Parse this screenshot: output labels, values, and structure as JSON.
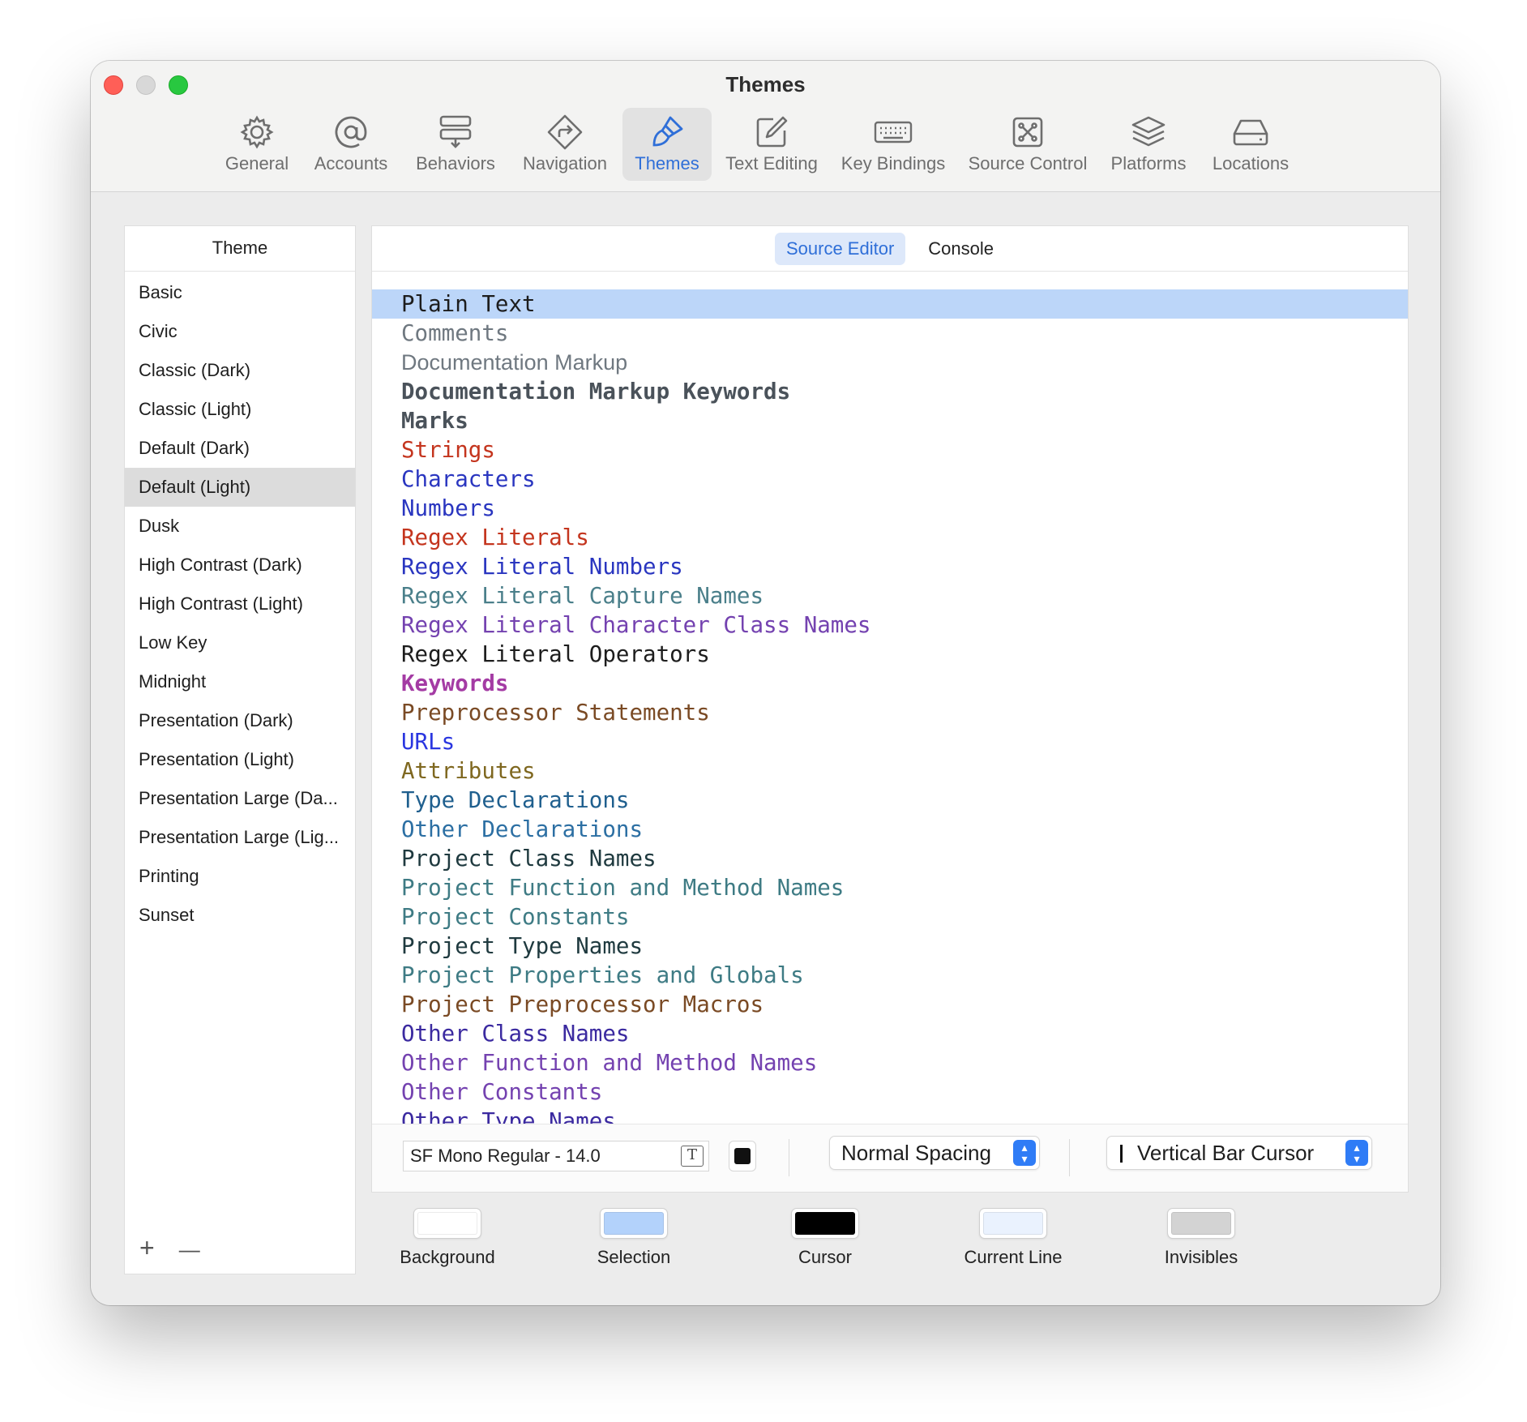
{
  "window": {
    "title": "Themes"
  },
  "toolbar": {
    "items": [
      {
        "label": "General",
        "icon": "gear-icon"
      },
      {
        "label": "Accounts",
        "icon": "at-icon"
      },
      {
        "label": "Behaviors",
        "icon": "behaviors-icon"
      },
      {
        "label": "Navigation",
        "icon": "navigation-icon"
      },
      {
        "label": "Themes",
        "icon": "paintbrush-icon"
      },
      {
        "label": "Text Editing",
        "icon": "pencil-square-icon"
      },
      {
        "label": "Key Bindings",
        "icon": "keyboard-icon"
      },
      {
        "label": "Source Control",
        "icon": "source-control-icon"
      },
      {
        "label": "Platforms",
        "icon": "layers-icon"
      },
      {
        "label": "Locations",
        "icon": "drive-icon"
      }
    ],
    "active": "Themes"
  },
  "themes": {
    "header": "Theme",
    "items": [
      "Basic",
      "Civic",
      "Classic (Dark)",
      "Classic (Light)",
      "Default (Dark)",
      "Default (Light)",
      "Dusk",
      "High Contrast (Dark)",
      "High Contrast (Light)",
      "Low Key",
      "Midnight",
      "Presentation (Dark)",
      "Presentation (Light)",
      "Presentation Large (Da...",
      "Presentation Large (Lig...",
      "Printing",
      "Sunset"
    ],
    "selected": "Default (Light)",
    "add_label": "+",
    "remove_label": "—"
  },
  "editor": {
    "tabs": [
      "Source Editor",
      "Console"
    ],
    "active_tab": "Source Editor",
    "tokens": [
      {
        "label": "Plain Text",
        "color": "#1d1d1d",
        "bold": false,
        "selected": true
      },
      {
        "label": "Comments",
        "color": "#6f7880",
        "bold": false
      },
      {
        "label": "Documentation Markup",
        "color": "#6f7880",
        "bold": false,
        "proportional": true
      },
      {
        "label": "Documentation Markup Keywords",
        "color": "#4a525a",
        "bold": true
      },
      {
        "label": "Marks",
        "color": "#4a525a",
        "bold": true
      },
      {
        "label": "Strings",
        "color": "#c4351e",
        "bold": false
      },
      {
        "label": "Characters",
        "color": "#2a36c0",
        "bold": false
      },
      {
        "label": "Numbers",
        "color": "#2a36c0",
        "bold": false
      },
      {
        "label": "Regex Literals",
        "color": "#c4351e",
        "bold": false
      },
      {
        "label": "Regex Literal Numbers",
        "color": "#2a36c0",
        "bold": false
      },
      {
        "label": "Regex Literal Capture Names",
        "color": "#4a7f8a",
        "bold": false
      },
      {
        "label": "Regex Literal Character Class Names",
        "color": "#7442b0",
        "bold": false
      },
      {
        "label": "Regex Literal Operators",
        "color": "#1d1d1d",
        "bold": false
      },
      {
        "label": "Keywords",
        "color": "#a43ba4",
        "bold": true
      },
      {
        "label": "Preprocessor Statements",
        "color": "#7a4a24",
        "bold": false
      },
      {
        "label": "URLs",
        "color": "#2a36e0",
        "bold": false
      },
      {
        "label": "Attributes",
        "color": "#7f6820",
        "bold": false
      },
      {
        "label": "Type Declarations",
        "color": "#1f5f8e",
        "bold": false
      },
      {
        "label": "Other Declarations",
        "color": "#2c6fa3",
        "bold": false
      },
      {
        "label": "Project Class Names",
        "color": "#1f3a3f",
        "bold": false
      },
      {
        "label": "Project Function and Method Names",
        "color": "#3e7b84",
        "bold": false
      },
      {
        "label": "Project Constants",
        "color": "#3e7b84",
        "bold": false
      },
      {
        "label": "Project Type Names",
        "color": "#1f3a3f",
        "bold": false
      },
      {
        "label": "Project Properties and Globals",
        "color": "#3e7b84",
        "bold": false
      },
      {
        "label": "Project Preprocessor Macros",
        "color": "#7a4a24",
        "bold": false
      },
      {
        "label": "Other Class Names",
        "color": "#3b2aa0",
        "bold": false
      },
      {
        "label": "Other Function and Method Names",
        "color": "#7442b0",
        "bold": false
      },
      {
        "label": "Other Constants",
        "color": "#7442b0",
        "bold": false
      },
      {
        "label": "Other Type Names",
        "color": "#3b2aa0",
        "bold": false
      }
    ],
    "font": {
      "value": "SF Mono Regular - 14.0",
      "icon": "text-format-icon"
    },
    "spacing": {
      "selected": "Normal Spacing"
    },
    "cursor_style": {
      "selected": "Vertical Bar Cursor"
    }
  },
  "swatches": [
    {
      "label": "Background",
      "color": "#ffffff"
    },
    {
      "label": "Selection",
      "color": "#b3d2fb"
    },
    {
      "label": "Cursor",
      "color": "#000000"
    },
    {
      "label": "Current Line",
      "color": "#eaf2fe"
    },
    {
      "label": "Invisibles",
      "color": "#d3d3d3"
    }
  ]
}
